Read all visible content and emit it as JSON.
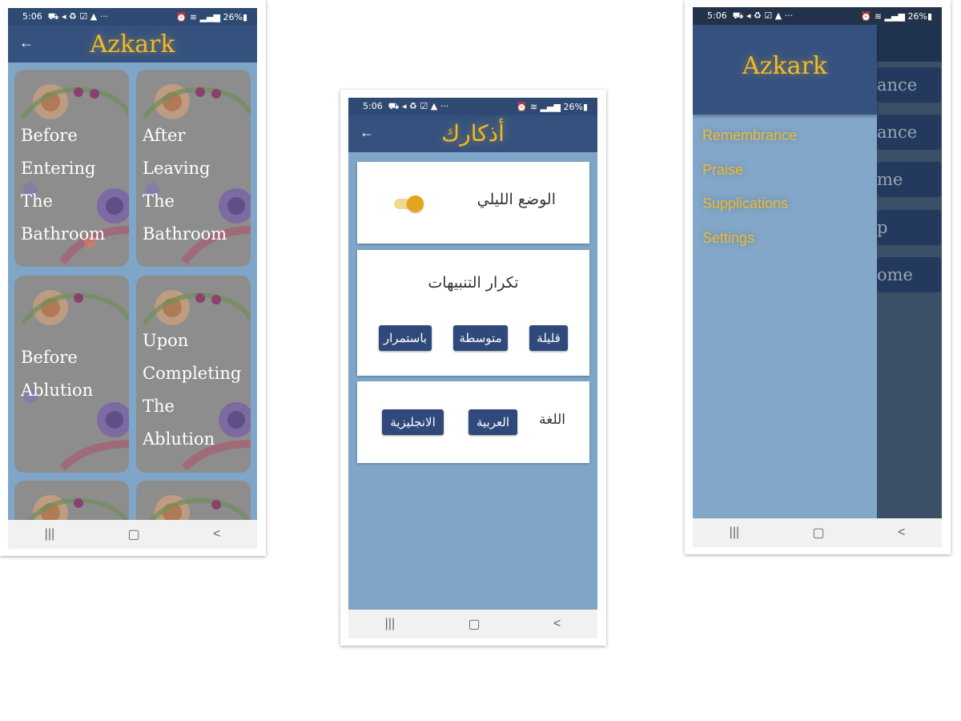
{
  "status": {
    "time": "5:06",
    "icons_left": "⛟ ◂ ♻ ☑ ▲ ···",
    "battery": "26%"
  },
  "screen1": {
    "title": "Azkark",
    "tiles": [
      {
        "label": "Before Entering The Bathroom"
      },
      {
        "label": "After Leaving The Bathroom"
      },
      {
        "label": "Before Ablution"
      },
      {
        "label": "Upon Completing The Ablution"
      },
      {
        "label": ""
      },
      {
        "label": ""
      }
    ]
  },
  "screen2": {
    "title": "أذكارك",
    "night_mode_label": "الوضع الليلي",
    "night_mode_on": true,
    "repeat_title": "تكرار التنبيهات",
    "repeat_options": [
      "قليلة",
      "متوسطة",
      "باستمرار"
    ],
    "language_label": "اللغة",
    "language_options": [
      "العربية",
      "الانجليزية"
    ]
  },
  "screen3": {
    "title": "Azkark",
    "menu": [
      "Remembrance",
      "Praise",
      "Supplications",
      "Settings"
    ],
    "background_items": [
      "ance",
      "ance",
      "me",
      "p",
      "ome"
    ]
  },
  "colors": {
    "appbar": "#35527f",
    "statusbar": "#2f4a72",
    "accent": "#f2b928",
    "body": "#7fa6c9",
    "button": "#2f4a7a"
  }
}
